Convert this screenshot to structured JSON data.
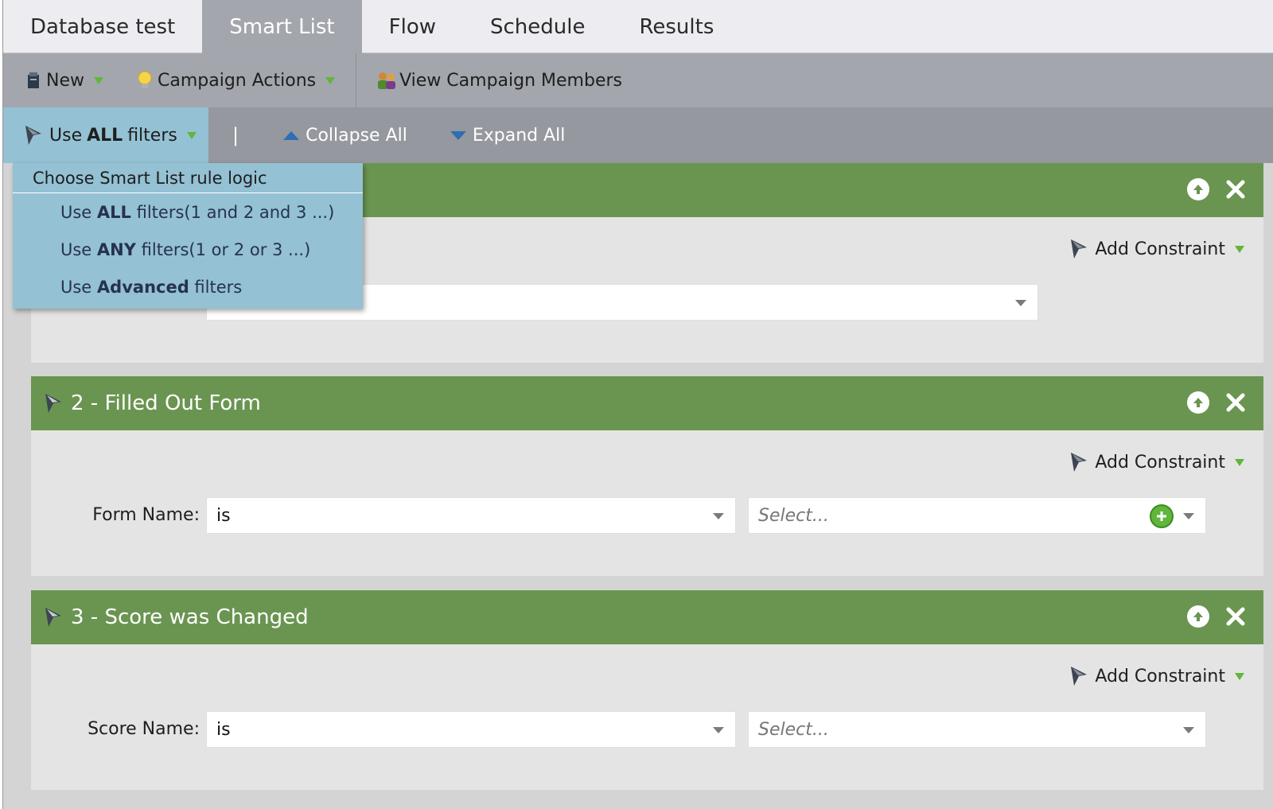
{
  "tabs": [
    {
      "label": "Database test",
      "active": false
    },
    {
      "label": "Smart List",
      "active": true
    },
    {
      "label": "Flow",
      "active": false
    },
    {
      "label": "Schedule",
      "active": false
    },
    {
      "label": "Results",
      "active": false
    }
  ],
  "toolbar": {
    "new_label": "New",
    "campaign_actions_label": "Campaign Actions",
    "view_members_label": "View Campaign Members"
  },
  "filterbar": {
    "logic_prefix": "Use",
    "logic_bold": "ALL",
    "logic_suffix": "filters",
    "separator": "|",
    "collapse_label": "Collapse All",
    "expand_label": "Expand All"
  },
  "logic_menu": {
    "header": "Choose Smart List rule logic",
    "items": [
      {
        "prefix": "Use ",
        "bold": "ALL",
        "suffix": " filters(1 and 2 and 3 ...)"
      },
      {
        "prefix": "Use ",
        "bold": "ANY",
        "suffix": " filters(1 or 2 or 3 ...)"
      },
      {
        "prefix": "Use ",
        "bold": "Advanced",
        "suffix": " filters"
      }
    ]
  },
  "filters": [
    {
      "title": "",
      "add_constraint": "Add Constraint"
    },
    {
      "title": "2 - Filled Out Form",
      "add_constraint": "Add Constraint",
      "field_label": "Form Name:",
      "operator": "is",
      "value_placeholder": "Select..."
    },
    {
      "title": "3 - Score was Changed",
      "add_constraint": "Add Constraint",
      "field_label": "Score Name:",
      "operator": "is",
      "value_placeholder": "Select..."
    }
  ],
  "colors": {
    "filter_header": "#6a9551",
    "menu_bg": "#94c1d4",
    "toolbar_bg": "#a3a6ad",
    "caret_green": "#5fb63a"
  }
}
